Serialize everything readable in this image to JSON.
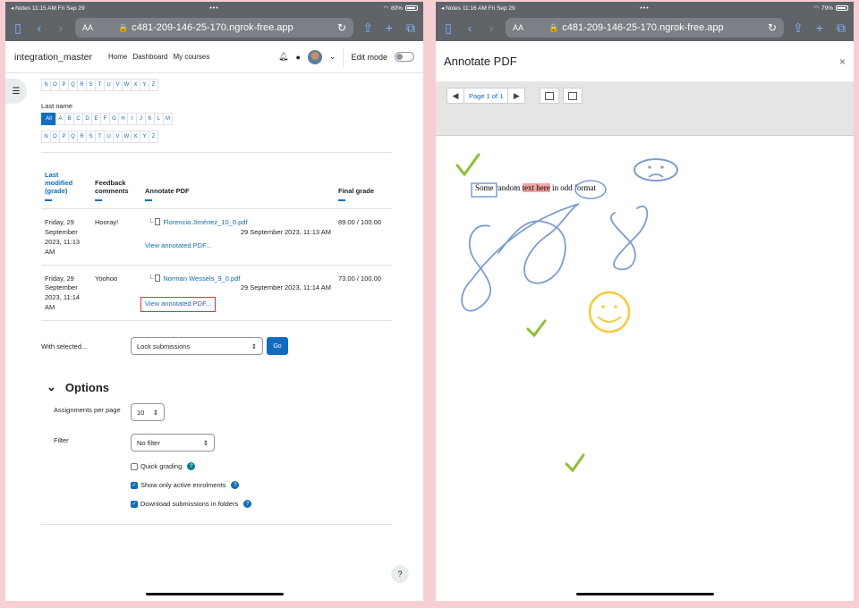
{
  "left": {
    "status": {
      "app": "◂ Notes",
      "time": "11:15 AM",
      "date": "Fri Sep 29",
      "battery": "80%"
    },
    "browser": {
      "text_size": "AA",
      "url": "c481-209-146-25-170.ngrok-free.app"
    },
    "nav": {
      "brand": "integration_master",
      "links": [
        "Home",
        "Dashboard",
        "My courses"
      ],
      "edit_mode": "Edit mode"
    },
    "filters": {
      "first_row_letters": [
        "N",
        "O",
        "P",
        "Q",
        "R",
        "S",
        "T",
        "U",
        "V",
        "W",
        "X",
        "Y",
        "Z"
      ],
      "last_name_label": "Last name",
      "last_name_letters": [
        "All",
        "A",
        "B",
        "C",
        "D",
        "E",
        "F",
        "G",
        "H",
        "I",
        "J",
        "K",
        "L",
        "M"
      ],
      "last_name_letters2": [
        "N",
        "O",
        "P",
        "Q",
        "R",
        "S",
        "T",
        "U",
        "V",
        "W",
        "X",
        "Y",
        "Z"
      ]
    },
    "table": {
      "headers": {
        "last_modified": "Last modified (grade)",
        "feedback": "Feedback comments",
        "annotate": "Annotate PDF",
        "final": "Final grade"
      },
      "rows": [
        {
          "date": "Friday, 29 September 2023, 11:13 AM",
          "feedback": "Hooray!",
          "file": "Florencia Jiménez_10_0.pdf",
          "file_date": "29 September 2023, 11:13 AM",
          "view": "View annotated PDF...",
          "grade": "89.00 / 100.00"
        },
        {
          "date": "Friday, 29 September 2023, 11:14 AM",
          "feedback": "Yoohoo",
          "file": "Norman Wessels_9_0.pdf",
          "file_date": "29 September 2023, 11:14 AM",
          "view": "View annotated PDF...",
          "grade": "73.00 / 100.00"
        }
      ]
    },
    "with_selected": {
      "label": "With selected...",
      "select": "Lock submissions",
      "go": "Go"
    },
    "options": {
      "title": "Options",
      "assignments_label": "Assignments per page",
      "assignments_value": "10",
      "filter_label": "Filter",
      "filter_value": "No filter",
      "quick_grading": "Quick grading",
      "active_enrolments": "Show only active enrolments",
      "download_folders": "Download submissions in folders"
    },
    "help": "?"
  },
  "right": {
    "status": {
      "app": "◂ Notes",
      "time": "11:16 AM",
      "date": "Fri Sep 29",
      "battery": "79%"
    },
    "browser": {
      "text_size": "AA",
      "url": "c481-209-146-25-170.ngrok-free.app"
    },
    "dialog": {
      "title": "Annotate PDF",
      "close": "×",
      "page_info": "Page 1 of 1"
    },
    "pdf_text": {
      "part1": "Some ",
      "part2": "random ",
      "highlighted": "text here",
      "part3": " in odd ",
      "part4": "format"
    }
  },
  "colors": {
    "accent": "#0f6cbf",
    "highlight_box": "#e0333f",
    "annotation_blue": "#7b9dd1",
    "annotation_green": "#8fbf2f",
    "annotation_yellow": "#f4cc3c",
    "page_bg": "#f7cfd3"
  }
}
